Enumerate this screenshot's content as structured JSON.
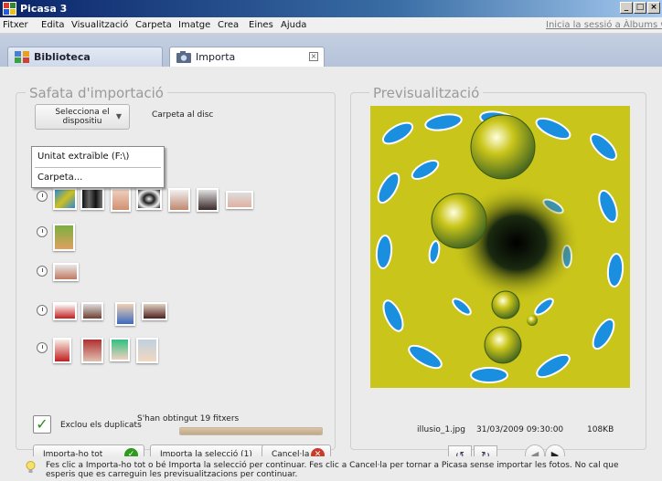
{
  "window": {
    "title": "Picasa 3",
    "minimize": "_",
    "maximize": "□",
    "close": "×"
  },
  "menu": {
    "items": [
      "Fitxer",
      "Edita",
      "Visualització",
      "Carpeta",
      "Imatge",
      "Crea",
      "Eines",
      "Ajuda"
    ],
    "signin": "Inicia la sessió a Àlbums web"
  },
  "tabs": {
    "library": "Biblioteca",
    "import": "Importa",
    "import_close": "×"
  },
  "import_panel": {
    "title": "Safata d'importació",
    "device_select": "Selecciona el dispositiu",
    "folder_label": "Carpeta al disc",
    "dropdown": [
      "Unitat extraïble (F:\\)",
      "Carpeta..."
    ],
    "exclude_duplicates": "Exclou els duplicats",
    "exclude_checked": "✓",
    "files_found": "S'han obtingut 19 fitxers",
    "progress": 1.0,
    "buttons": {
      "import_all": "Importa-ho tot",
      "import_selection": "Importa la selecció (1)",
      "cancel": "Cancel·la"
    }
  },
  "preview_panel": {
    "title": "Previsualització",
    "filename": "illusio_1.jpg",
    "date": "31/03/2009 09:30:00",
    "size": "108KB",
    "rotate_left": "↺",
    "rotate_right": "↻",
    "prev": "◀",
    "next": "▶"
  },
  "hint": "Fes clic a Importa-ho tot o bé Importa la selecció per continuar. Fes clic a Cancel·la per tornar a Picasa sense importar les fotos. No cal que esperis que es carreguin les previsualitzacions per continuar.",
  "colors": {
    "accent_green": "#2e9a1e",
    "cancel_red": "#c83a2a",
    "preview_yellow": "#c9c51a",
    "preview_blue": "#1a8fe0"
  }
}
